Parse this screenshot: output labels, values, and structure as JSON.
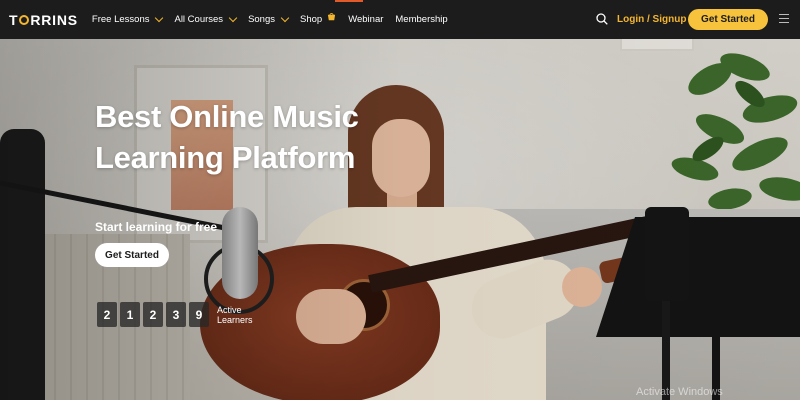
{
  "header": {
    "logo": {
      "prefix": "T",
      "suffix": "RRINS"
    },
    "nav": [
      {
        "label": "Free Lessons",
        "dropdown": true
      },
      {
        "label": "All Courses",
        "dropdown": true
      },
      {
        "label": "Songs",
        "dropdown": true
      },
      {
        "label": "Shop",
        "icon": "cart-icon"
      },
      {
        "label": "Webinar"
      },
      {
        "label": "Membership"
      }
    ],
    "login_label": "Login / Signup",
    "get_started_label": "Get Started",
    "icons": {
      "search": "search-icon",
      "menu": "hamburger-menu-icon"
    }
  },
  "hero": {
    "title_line1": "Best Online Music",
    "title_line2": "Learning Platform",
    "subtitle": "Start learning for free",
    "cta_label": "Get Started",
    "counter": {
      "digits": [
        "2",
        "1",
        "2",
        "3",
        "9"
      ],
      "label_line1": "Active",
      "label_line2": "Learners"
    }
  },
  "overlay": {
    "watermark": "Activate Windows"
  },
  "colors": {
    "nav_bg": "#1c1c1c",
    "accent": "#f7c23c",
    "login": "#f4b62e",
    "text_light": "#ffffff"
  }
}
